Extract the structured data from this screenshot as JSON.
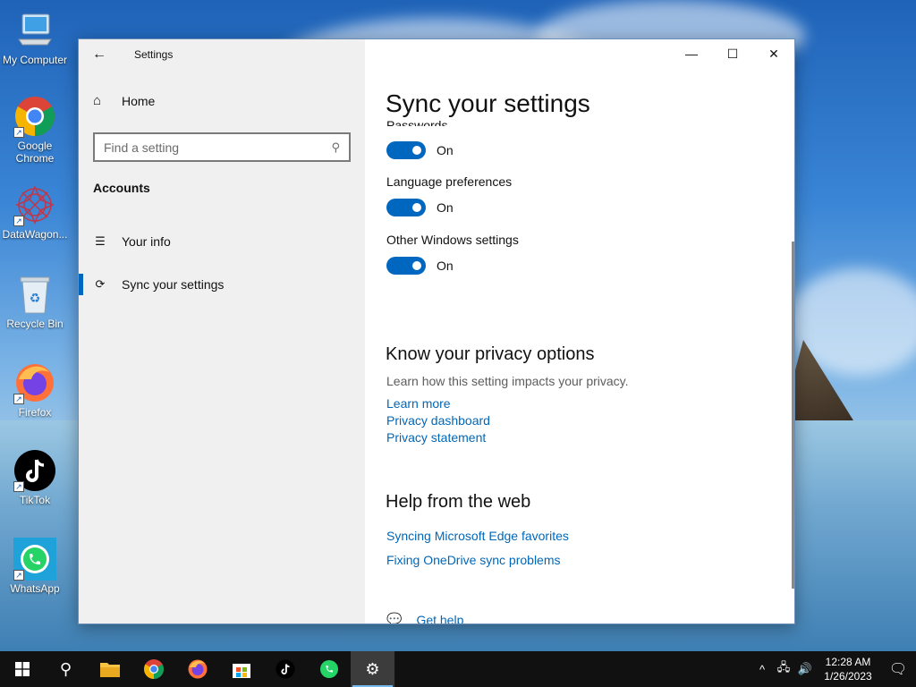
{
  "desktop": {
    "icons": [
      {
        "label": "My Computer",
        "icon": "computer-icon"
      },
      {
        "label": "Google Chrome",
        "icon": "chrome-icon"
      },
      {
        "label": "DataWagon...",
        "icon": "datawagon-icon"
      },
      {
        "label": "Recycle Bin",
        "icon": "recycle-bin-icon"
      },
      {
        "label": "Firefox",
        "icon": "firefox-icon"
      },
      {
        "label": "TikTok",
        "icon": "tiktok-icon"
      },
      {
        "label": "WhatsApp",
        "icon": "whatsapp-icon"
      }
    ]
  },
  "window": {
    "app_title": "Settings",
    "nav": {
      "home": "Home",
      "search_placeholder": "Find a setting",
      "section": "Accounts",
      "items": [
        {
          "label": "Your info",
          "icon": "person-list-icon"
        },
        {
          "label": "Sync your settings",
          "icon": "sync-icon",
          "active": true
        }
      ]
    },
    "content": {
      "title": "Sync your settings",
      "partial_label": "Passwords",
      "partial_toggle": "On",
      "settings": [
        {
          "label": "Language preferences",
          "state": "On"
        },
        {
          "label": "Other Windows settings",
          "state": "On"
        }
      ],
      "privacy": {
        "heading": "Know your privacy options",
        "description": "Learn how this setting impacts your privacy.",
        "links": [
          "Learn more",
          "Privacy dashboard",
          "Privacy statement"
        ]
      },
      "help": {
        "heading": "Help from the web",
        "links": [
          "Syncing Microsoft Edge favorites",
          "Fixing OneDrive sync problems"
        ],
        "get_help": "Get help"
      }
    }
  },
  "taskbar": {
    "apps": [
      "start-icon",
      "search-icon",
      "file-explorer-icon",
      "chrome-icon",
      "firefox-icon",
      "store-icon",
      "tiktok-icon",
      "whatsapp-icon",
      "settings-icon"
    ],
    "time": "12:28 AM",
    "date": "1/26/2023"
  },
  "colors": {
    "accent": "#0067c0",
    "link": "#0067b8",
    "nav_bg": "#f0f0f0",
    "taskbar": "#111111"
  }
}
